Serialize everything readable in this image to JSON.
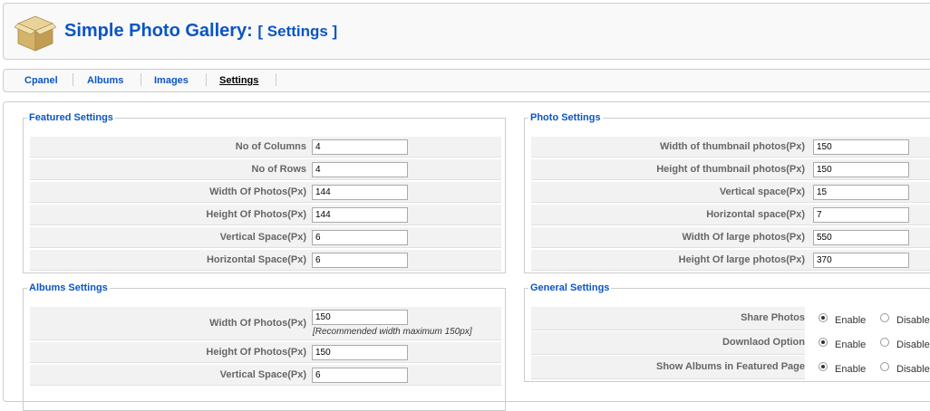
{
  "header": {
    "title": "Simple Photo Gallery:",
    "subtitle": "[ Settings ]",
    "logo_icon": "box-icon"
  },
  "tabs": [
    {
      "label": "Cpanel",
      "active": false
    },
    {
      "label": "Albums",
      "active": false
    },
    {
      "label": "Images",
      "active": false
    },
    {
      "label": "Settings",
      "active": true
    }
  ],
  "featured": {
    "legend": "Featured Settings",
    "rows": [
      {
        "label": "No of Columns",
        "value": "4"
      },
      {
        "label": "No of Rows",
        "value": "4"
      },
      {
        "label": "Width Of Photos(Px)",
        "value": "144"
      },
      {
        "label": "Height Of Photos(Px)",
        "value": "144"
      },
      {
        "label": "Vertical Space(Px)",
        "value": "6"
      },
      {
        "label": "Horizontal Space(Px)",
        "value": "6"
      }
    ]
  },
  "albums": {
    "legend": "Albums Settings",
    "rows": [
      {
        "label": "Width Of Photos(Px)",
        "value": "150",
        "hint": "[Recommended width maximum 150px]"
      },
      {
        "label": "Height Of Photos(Px)",
        "value": "150"
      },
      {
        "label": "Vertical Space(Px)",
        "value": "6"
      }
    ]
  },
  "photo": {
    "legend": "Photo Settings",
    "rows": [
      {
        "label": "Width of thumbnail photos(Px)",
        "value": "150"
      },
      {
        "label": "Height of thumbnail photos(Px)",
        "value": "150"
      },
      {
        "label": "Vertical space(Px)",
        "value": "15"
      },
      {
        "label": "Horizontal space(Px)",
        "value": "7"
      },
      {
        "label": "Width Of large photos(Px)",
        "value": "550"
      },
      {
        "label": "Height Of large photos(Px)",
        "value": "370"
      }
    ]
  },
  "general": {
    "legend": "General Settings",
    "enable_label": "Enable",
    "disable_label": "Disable",
    "rows": [
      {
        "label": "Share Photos",
        "selected": "Enable"
      },
      {
        "label": "Downlaod Option",
        "selected": "Enable"
      },
      {
        "label": "Show Albums in Featured Page",
        "selected": "Enable"
      }
    ]
  }
}
